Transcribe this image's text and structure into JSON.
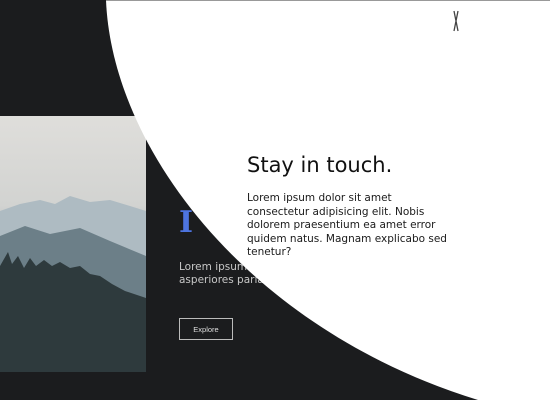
{
  "background": {
    "heading_glyph": "I",
    "text": "Lorem ipsum dolor sit amet. Ullam asperiores pariatur quo id",
    "button": "Explore"
  },
  "modal": {
    "title": "Stay in touch.",
    "body": "Lorem ipsum dolor sit amet consectetur adipisicing elit. Nobis dolorem praesentium ea amet error quidem natus. Magnam explicabo sed tenetur?",
    "close_icon": "close-icon"
  },
  "colors": {
    "background": "#1b1c1e",
    "accent": "#4d74e0",
    "modal": "#ffffff"
  }
}
